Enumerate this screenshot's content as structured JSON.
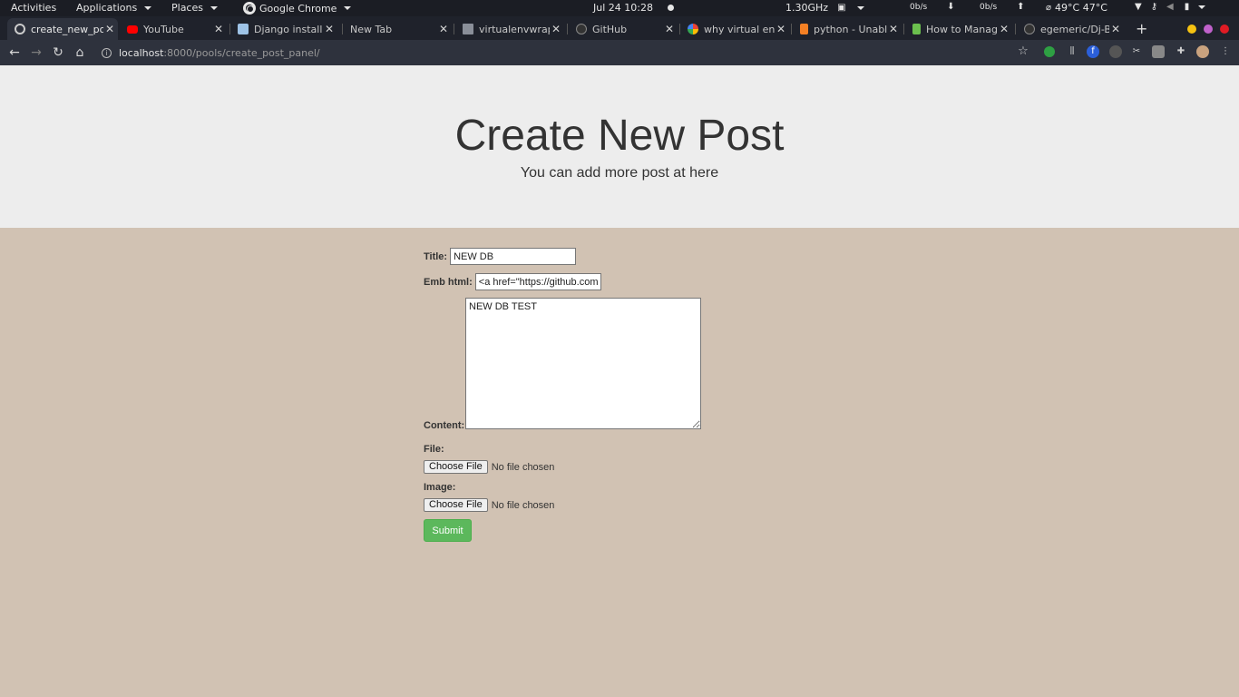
{
  "system_bar": {
    "activities": "Activities",
    "applications": "Applications",
    "places": "Places",
    "app_name": "Google Chrome",
    "datetime": "Jul 24  10:28",
    "cpu": "1.30GHz",
    "net_down": "0b/s",
    "net_up": "0b/s",
    "temps": "49°C 47°C"
  },
  "tabs": [
    {
      "label": "create_new_post",
      "favicon_color": "#cccccc",
      "active": true
    },
    {
      "label": "YouTube",
      "favicon_color": "#ff0000",
      "active": false
    },
    {
      "label": "Django installation",
      "favicon_color": "#9ec3e6",
      "active": false
    },
    {
      "label": "New Tab",
      "favicon_color": "",
      "active": false
    },
    {
      "label": "virtualenvwrapper",
      "favicon_color": "#8a8f99",
      "active": false
    },
    {
      "label": "GitHub",
      "favicon_color": "#333333",
      "active": false
    },
    {
      "label": "why virtual env",
      "favicon_color": "#4285f4",
      "active": false
    },
    {
      "label": "python - Unable",
      "favicon_color": "#f48024",
      "active": false
    },
    {
      "label": "How to Manage",
      "favicon_color": "#6bbf4e",
      "active": false
    },
    {
      "label": "egemeric/Dj-Blog",
      "favicon_color": "#333333",
      "active": false
    }
  ],
  "address_bar": {
    "host": "localhost",
    "path": ":8000/pools/create_post_panel/"
  },
  "page": {
    "title": "Create New Post",
    "subtitle": "You can add more post at here"
  },
  "form": {
    "title_label": "Title:",
    "title_value": "NEW DB",
    "emb_label": "Emb html:",
    "emb_value": "<a href=\"https://github.com/e",
    "content_label": "Content:",
    "content_value": "NEW DB TEST",
    "file_label": "File:",
    "image_label": "Image:",
    "choose_file": "Choose File",
    "no_file": "No file chosen",
    "submit": "Submit"
  },
  "colors": {
    "hero_bg": "#ededed",
    "page_bg": "#d1c2b3",
    "submit_bg": "#5cb85c"
  }
}
